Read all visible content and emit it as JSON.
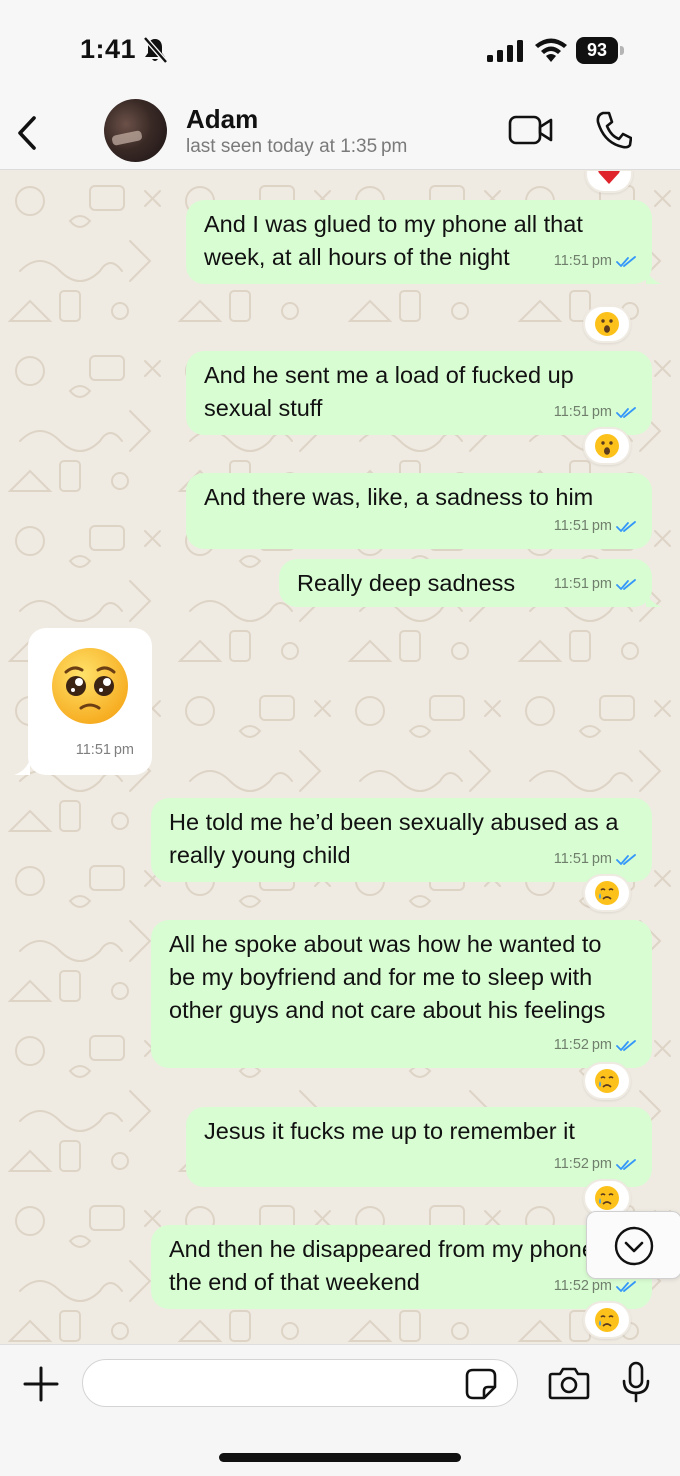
{
  "status_bar": {
    "time": "1:41",
    "battery": "93",
    "silent_icon": "bell-slash-icon",
    "signal_icon": "cellular-signal-icon",
    "wifi_icon": "wifi-icon"
  },
  "header": {
    "contact_name": "Adam",
    "last_seen": "last seen today at 1:35 pm",
    "icons": [
      "chevron-left-icon",
      "video-camera-icon",
      "phone-icon"
    ]
  },
  "messages": [
    {
      "direction": "out",
      "text": "And I was glued to my phone all that week, at all hours of the night",
      "time": "11:51 pm",
      "status": "read",
      "reaction": "hushed-face"
    },
    {
      "direction": "out",
      "text": "And he sent me a load of fucked up sexual stuff",
      "time": "11:51 pm",
      "status": "read",
      "reaction": "hushed-face"
    },
    {
      "direction": "out",
      "text": "And there was, like, a sadness to him",
      "time": "11:51 pm",
      "status": "read"
    },
    {
      "direction": "out",
      "text": "Really deep sadness",
      "time": "11:51 pm",
      "status": "read"
    },
    {
      "direction": "in",
      "emoji": "pleading-face",
      "time": "11:51 pm"
    },
    {
      "direction": "out",
      "text": "He told me he’d been sexually abused as a really young child",
      "time": "11:51 pm",
      "status": "read",
      "reaction": "crying-face"
    },
    {
      "direction": "out",
      "text": "All he spoke about was how he wanted to be my boyfriend and for me to sleep with other guys and not care about his feelings",
      "time": "11:52 pm",
      "status": "read",
      "reaction": "crying-face"
    },
    {
      "direction": "out",
      "text": "Jesus it fucks me up to remember it",
      "time": "11:52 pm",
      "status": "read",
      "reaction": "crying-face"
    },
    {
      "direction": "out",
      "text": "And then he disappeared from my phone at the end of that weekend",
      "time": "11:52 pm",
      "status": "read",
      "reaction": "crying-face"
    }
  ],
  "top_partial_reaction": "red-heart",
  "input": {
    "placeholder": "",
    "value": ""
  },
  "colors": {
    "outgoing_bubble": "#d9fdd3",
    "incoming_bubble": "#ffffff",
    "chat_background": "#efeae2",
    "read_ticks": "#53bdeb"
  }
}
